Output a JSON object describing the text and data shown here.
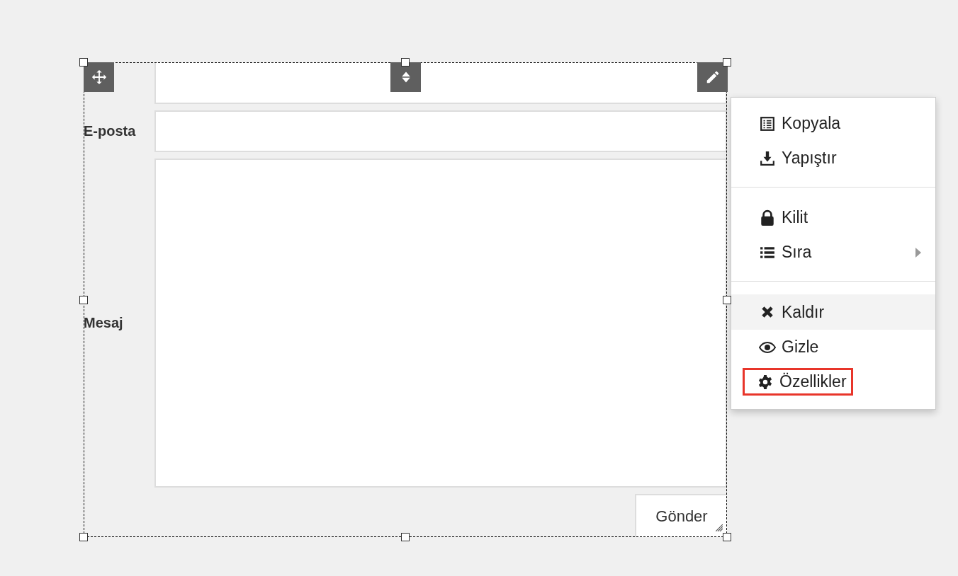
{
  "form": {
    "fields": [
      {
        "kind": "input"
      },
      {
        "label": "E-posta",
        "kind": "input"
      },
      {
        "label": "Mesaj",
        "kind": "textarea"
      }
    ],
    "submit": "Gönder"
  },
  "context_menu": {
    "items": [
      {
        "kind": "item",
        "label": "Kopyala",
        "hovered": false,
        "highlighted": false,
        "submenu": false
      },
      {
        "kind": "item",
        "label": "Yapıştır",
        "hovered": false,
        "highlighted": false,
        "submenu": false
      },
      {
        "kind": "divider"
      },
      {
        "kind": "item",
        "label": "Kilit",
        "hovered": false,
        "highlighted": false,
        "submenu": false
      },
      {
        "kind": "item",
        "label": "Sıra",
        "hovered": false,
        "highlighted": false,
        "submenu": true
      },
      {
        "kind": "divider"
      },
      {
        "kind": "item",
        "label": "Kaldır",
        "hovered": true,
        "highlighted": false,
        "submenu": false
      },
      {
        "kind": "item",
        "label": "Gizle",
        "hovered": false,
        "highlighted": false,
        "submenu": false
      },
      {
        "kind": "item",
        "label": "Özellikler",
        "hovered": false,
        "highlighted": true,
        "submenu": false
      }
    ]
  }
}
